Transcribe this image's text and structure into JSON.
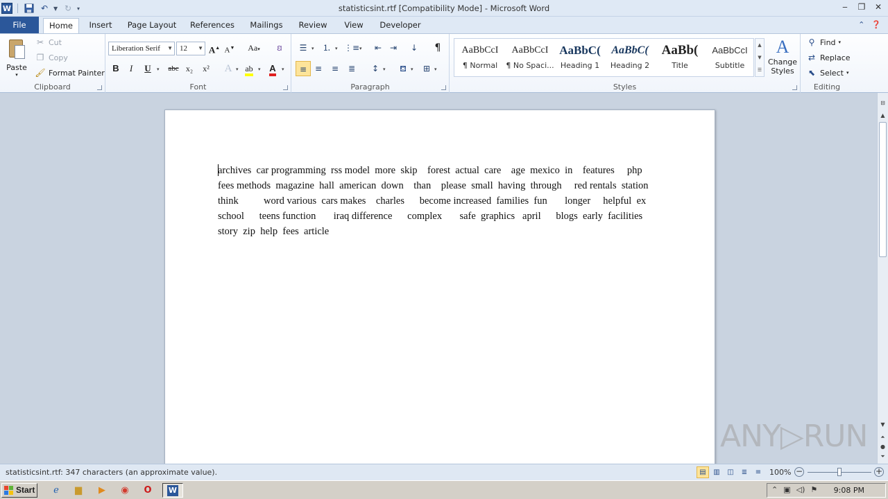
{
  "titlebar": {
    "title": "statisticsint.rtf [Compatibility Mode]  -  Microsoft Word",
    "app_logo": "W",
    "qat_icons": [
      "save-icon",
      "undo-icon",
      "redo-icon",
      "customize-icon"
    ]
  },
  "tabs": [
    "File",
    "Home",
    "Insert",
    "Page Layout",
    "References",
    "Mailings",
    "Review",
    "View",
    "Developer"
  ],
  "active_tab": "Home",
  "clipboard": {
    "paste": "Paste",
    "cut": "Cut",
    "copy": "Copy",
    "format_painter": "Format Painter",
    "label": "Clipboard"
  },
  "font": {
    "name": "Liberation Serif",
    "size": "12",
    "label": "Font",
    "bold": "B",
    "italic": "I",
    "underline": "U",
    "strike": "abc",
    "subscript": "x₂",
    "superscript": "x²",
    "grow": "A",
    "shrink": "A",
    "case": "Aa"
  },
  "paragraph": {
    "label": "Paragraph"
  },
  "styles": {
    "label": "Styles",
    "tiles": [
      {
        "sample": "AaBbCcI",
        "name": "¶ Normal"
      },
      {
        "sample": "AaBbCcI",
        "name": "¶ No Spaci..."
      },
      {
        "sample": "AaBbC(",
        "name": "Heading 1"
      },
      {
        "sample": "AaBbC(",
        "name": "Heading 2"
      },
      {
        "sample": "AaBb(",
        "name": "Title"
      },
      {
        "sample": "AaBbCcI",
        "name": "Subtitle"
      }
    ],
    "change": "Change Styles"
  },
  "editing": {
    "label": "Editing",
    "find": "Find",
    "replace": "Replace",
    "select": "Select"
  },
  "document": {
    "lines": [
      "archives  car programming  rss model  more  skip    forest  actual  care    age  mexico  in    features     php",
      "fees methods  magazine  hall  american  down    than    please  small  having  through     red rentals  station",
      "think          word various  cars makes    charles      become increased  families  fun       longer     helpful  ex",
      "school      teens function       iraq difference      complex       safe  graphics   april      blogs  early  facilities",
      "story  zip  help  fees  article"
    ]
  },
  "status": {
    "text": "statisticsint.rtf: 347 characters (an approximate value).",
    "zoom": "100%"
  },
  "watermark": "ANY▷RUN",
  "taskbar": {
    "start": "Start",
    "clock": "9:08 PM"
  }
}
